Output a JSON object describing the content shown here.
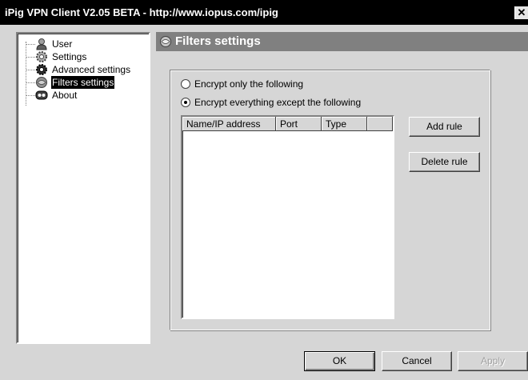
{
  "window": {
    "title": "iPig VPN Client V2.05 BETA  -  http://www.iopus.com/ipig",
    "close_label": "✕"
  },
  "tree": {
    "items": [
      {
        "label": "User",
        "icon": "user-icon"
      },
      {
        "label": "Settings",
        "icon": "gear-icon"
      },
      {
        "label": "Advanced settings",
        "icon": "advanced-gear-icon"
      },
      {
        "label": "Filters settings",
        "icon": "filter-icon",
        "selected": true
      },
      {
        "label": "About",
        "icon": "about-icon"
      }
    ]
  },
  "panel": {
    "header_title": "Filters settings",
    "header_icon": "filter-icon"
  },
  "filters": {
    "radio_encrypt_only": "Encrypt only the following",
    "radio_encrypt_everything": "Encrypt everything  except the following",
    "selected": "encrypt_everything",
    "columns": [
      "Name/IP address",
      "Port",
      "Type"
    ],
    "rows": [],
    "add_rule_label": "Add rule",
    "delete_rule_label": "Delete rule"
  },
  "footer": {
    "ok_label": "OK",
    "cancel_label": "Cancel",
    "apply_label": "Apply"
  }
}
